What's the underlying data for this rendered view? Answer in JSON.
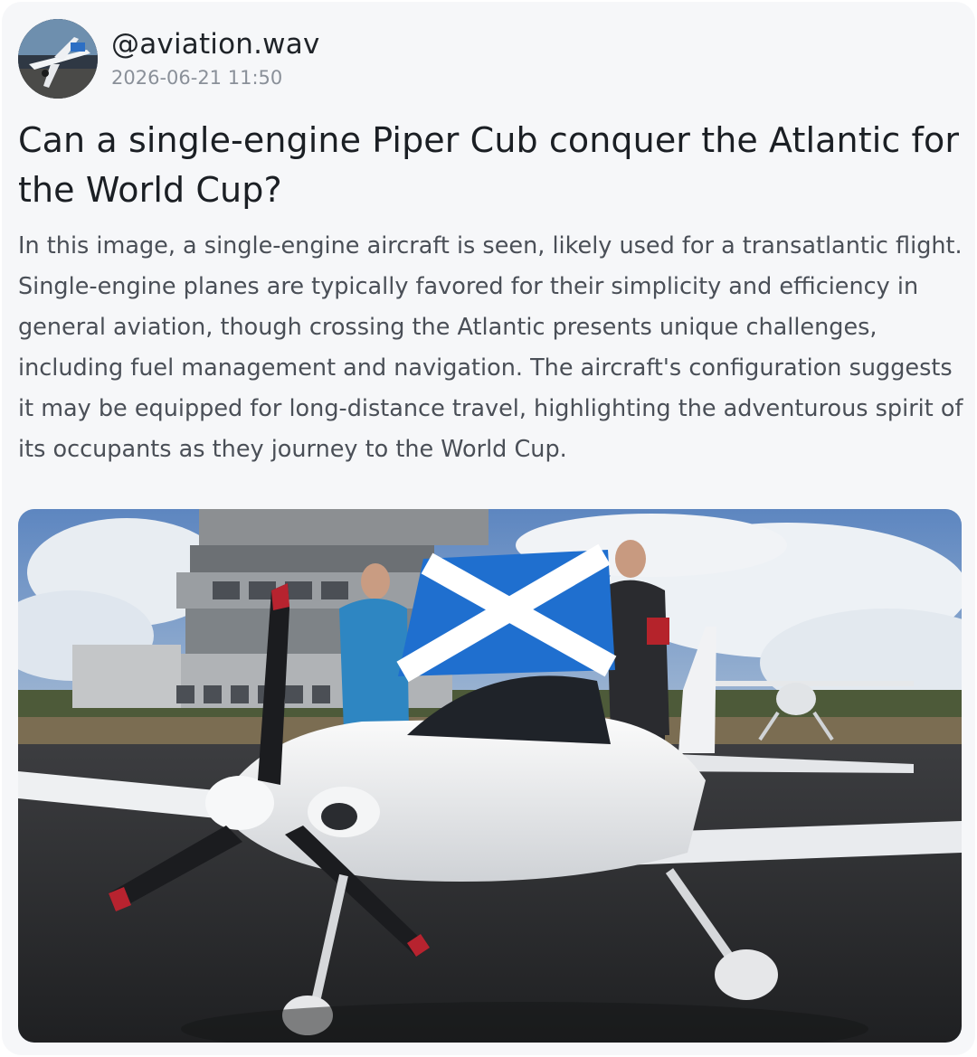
{
  "post": {
    "username": "@aviation.wav",
    "timestamp": "2026-06-21 11:50",
    "title": "Can a single-engine Piper Cub conquer the Atlantic for the World Cup?",
    "body": "In this image, a single-engine aircraft is seen, likely used for a transatlantic flight. Single-engine planes are typically favored for their simplicity and efficiency in general aviation, though crossing the Atlantic presents unique challenges, including fuel management and navigation. The aircraft's configuration suggests it may be equipped for long-distance travel, highlighting the adventurous spirit of its occupants as they journey to the World Cup."
  },
  "icons": {
    "avatar": "small-plane-photo-avatar",
    "photo": "plane-with-saltire-flag-photo"
  },
  "colors": {
    "card_background": "#f6f7f9",
    "title_text": "#1b1f24",
    "body_text": "#4a4f57",
    "timestamp_text": "#8a9099",
    "flag_blue": "#1f6fcf"
  }
}
